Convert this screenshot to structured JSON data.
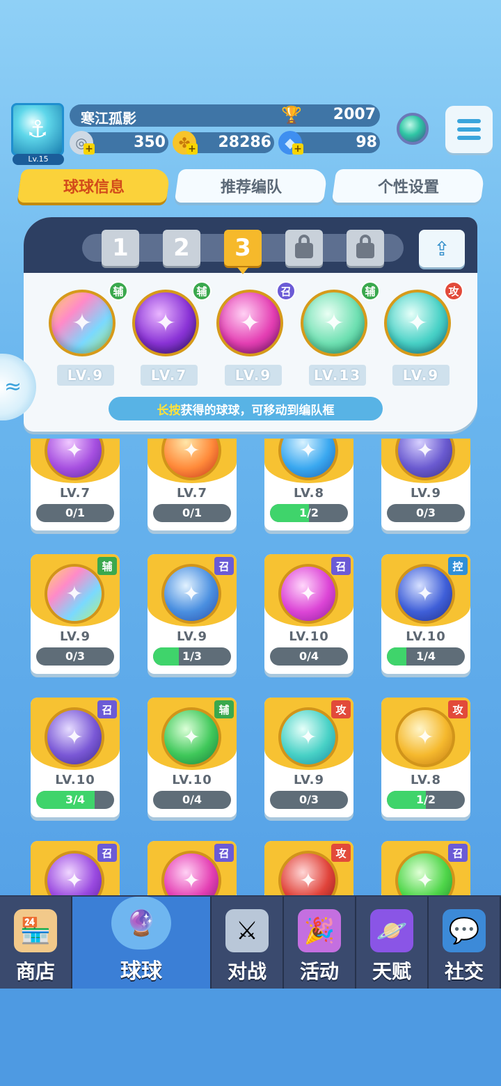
{
  "player": {
    "name": "寒江孤影",
    "level_tag": "Lv.15",
    "trophies": "2007",
    "currency_1": "350",
    "coins": "28286",
    "gems": "98"
  },
  "tabs": [
    {
      "label": "球球信息",
      "active": true
    },
    {
      "label": "推荐编队",
      "active": false
    },
    {
      "label": "个性设置",
      "active": false
    }
  ],
  "team_slots": [
    {
      "label": "1",
      "state": "normal"
    },
    {
      "label": "2",
      "state": "normal"
    },
    {
      "label": "3",
      "state": "active"
    },
    {
      "label": "",
      "state": "locked"
    },
    {
      "label": "",
      "state": "locked"
    }
  ],
  "team": [
    {
      "badge": "辅",
      "badge_type": "fu",
      "level": "LV.9",
      "orb": "linear-gradient(135deg,#ffd36b,#ff8ac8,#7ad9ff,#b4f07a)",
      "icon": "people-icon"
    },
    {
      "badge": "辅",
      "badge_type": "fu",
      "level": "LV.7",
      "orb": "radial-gradient(circle at 40% 35%,#e9b5ff,#8a33d6 55%,#3b1a7e)",
      "icon": "leaf-icon"
    },
    {
      "badge": "召",
      "badge_type": "zhao",
      "level": "LV.9",
      "orb": "radial-gradient(circle at 40% 35%,#ffd1f4,#e43fb3 55%,#8a1a7a)",
      "icon": "sword-icon"
    },
    {
      "badge": "辅",
      "badge_type": "fu",
      "level": "LV.13",
      "orb": "radial-gradient(circle at 40% 35%,#eafff4,#6fe0b2 55%,#2aa67a)",
      "icon": "sp-icon"
    },
    {
      "badge": "攻",
      "badge_type": "gong",
      "level": "LV.9",
      "orb": "radial-gradient(circle at 40% 35%,#e6fff9,#48d1c6 55%,#1a8aa0)",
      "icon": "tornado-icon"
    }
  ],
  "hint": {
    "highlight": "长按",
    "text": "获得的球球，可移动到编队框"
  },
  "cards": [
    {
      "badge": "",
      "badge_type": "",
      "level": "LV.7",
      "progress": "0/1",
      "fill": 0,
      "orb": "radial-gradient(circle at 40% 35%,#f0c8ff,#a64fe0 55%,#5a2a9e)",
      "icon": "butterfly-icon"
    },
    {
      "badge": "",
      "badge_type": "",
      "level": "LV.7",
      "progress": "0/1",
      "fill": 0,
      "orb": "radial-gradient(circle at 40% 35%,#ffe6a8,#ff8a3a 55%,#c2331a)",
      "icon": "wings-icon"
    },
    {
      "badge": "",
      "badge_type": "",
      "level": "LV.8",
      "progress": "1/2",
      "fill": 0.5,
      "orb": "radial-gradient(circle at 40% 35%,#d8f2ff,#3aa8f0 55%,#1b5fb0)",
      "icon": "wave-icon"
    },
    {
      "badge": "",
      "badge_type": "",
      "level": "LV.9",
      "progress": "0/3",
      "fill": 0,
      "orb": "radial-gradient(circle at 40% 35%,#d7d0ff,#6a5ad0 55%,#3a2f86)",
      "icon": "block-icon"
    },
    {
      "badge": "辅",
      "badge_type": "fu",
      "level": "LV.9",
      "progress": "0/3",
      "fill": 0,
      "orb": "linear-gradient(135deg,#ffd36b,#ff8ac8,#7ad9ff,#b4f07a)",
      "icon": "people-icon"
    },
    {
      "badge": "召",
      "badge_type": "zhao",
      "level": "LV.9",
      "progress": "1/3",
      "fill": 0.333,
      "orb": "radial-gradient(circle at 40% 35%,#e2f2ff,#4a8fe0 55%,#2a4fa8)",
      "icon": "vortex-icon"
    },
    {
      "badge": "召",
      "badge_type": "zhao",
      "level": "LV.10",
      "progress": "0/4",
      "fill": 0,
      "orb": "radial-gradient(circle at 40% 35%,#ffd6fb,#dc45d6 55%,#8e1f9a)",
      "icon": "mushroom-icon"
    },
    {
      "badge": "控",
      "badge_type": "kong",
      "level": "LV.10",
      "progress": "1/4",
      "fill": 0.25,
      "orb": "radial-gradient(circle at 40% 35%,#d6e0ff,#3f5fd8 55%,#1f2f8a)",
      "icon": "clock-icon"
    },
    {
      "badge": "召",
      "badge_type": "zhao",
      "level": "LV.10",
      "progress": "3/4",
      "fill": 0.75,
      "orb": "radial-gradient(circle at 40% 35%,#e6dcff,#7a58d6 55%,#3e2a8e)",
      "icon": "ghost-icon"
    },
    {
      "badge": "辅",
      "badge_type": "fu",
      "level": "LV.10",
      "progress": "0/4",
      "fill": 0,
      "orb": "radial-gradient(circle at 40% 35%,#dcffd8,#3fc85a 55%,#1a7a3a)",
      "icon": "star-arrow-icon"
    },
    {
      "badge": "攻",
      "badge_type": "gong",
      "level": "LV.9",
      "progress": "0/3",
      "fill": 0,
      "orb": "radial-gradient(circle at 40% 35%,#e6fff9,#48d1c6 55%,#1a8aa0)",
      "icon": "tornado-icon"
    },
    {
      "badge": "攻",
      "badge_type": "gong",
      "level": "LV.8",
      "progress": "1/2",
      "fill": 0.5,
      "orb": "radial-gradient(circle at 40% 35%,#fff5c8,#f5b92e 55%,#c27a12)",
      "icon": "shuriken-icon"
    },
    {
      "badge": "召",
      "badge_type": "zhao",
      "level": "",
      "progress": "",
      "fill": 0,
      "orb": "radial-gradient(circle at 40% 35%,#f0d6ff,#9a4ae0 55%,#5a1f9e)",
      "icon": "bubble-icon"
    },
    {
      "badge": "召",
      "badge_type": "zhao",
      "level": "",
      "progress": "",
      "fill": 0,
      "orb": "radial-gradient(circle at 40% 35%,#ffd1f4,#e43fb3 55%,#8a1a7a)",
      "icon": "sword-icon"
    },
    {
      "badge": "攻",
      "badge_type": "gong",
      "level": "",
      "progress": "",
      "fill": 0,
      "orb": "radial-gradient(circle at 40% 35%,#ffd6d6,#e0433a 55%,#8a1a1a)",
      "icon": "fist-icon"
    },
    {
      "badge": "召",
      "badge_type": "zhao",
      "level": "",
      "progress": "",
      "fill": 0,
      "orb": "radial-gradient(circle at 40% 35%,#e0ffd6,#4fd64a 55%,#1f8a2a)",
      "icon": "hexagram-icon"
    }
  ],
  "nav": [
    {
      "label": "商店",
      "icon": "shop-icon",
      "active": false
    },
    {
      "label": "球球",
      "icon": "ball-icon",
      "active": true
    },
    {
      "label": "对战",
      "icon": "crossed-swords-icon",
      "active": false
    },
    {
      "label": "活动",
      "icon": "party-popper-icon",
      "active": false
    },
    {
      "label": "天赋",
      "icon": "planet-icon",
      "active": false
    },
    {
      "label": "社交",
      "icon": "chat-heart-icon",
      "active": false
    }
  ],
  "colors": {
    "tab_active": "#fbd23a",
    "progress_fill": "#3fd46b",
    "nav_bg": "#2e3c5c",
    "nav_active": "#3b7fd6"
  }
}
